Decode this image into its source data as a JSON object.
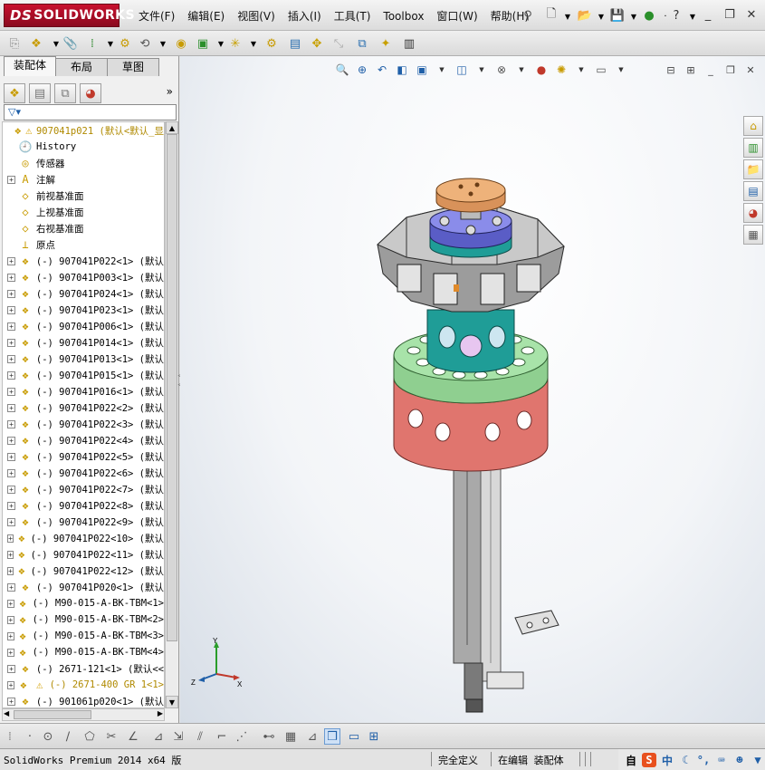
{
  "app": {
    "logo_text": "SOLIDWORKS",
    "logo_prefix": "DS"
  },
  "menu": [
    "文件(F)",
    "编辑(E)",
    "视图(V)",
    "插入(I)",
    "工具(T)",
    "Toolbox",
    "窗口(W)",
    "帮助(H)"
  ],
  "title_controls": {
    "help": "?"
  },
  "left_tabs": [
    "装配体",
    "布局",
    "草图"
  ],
  "active_tab": "装配体",
  "feature_manager": {
    "more_label": "»",
    "root": {
      "name": "907041p021  (默认<默认_显"
    },
    "items": [
      {
        "label": "History",
        "icon": "history-icon",
        "expand": false
      },
      {
        "label": "传感器",
        "icon": "sensor-icon",
        "expand": false
      },
      {
        "label": "注解",
        "icon": "annotation-icon",
        "expand": true
      },
      {
        "label": "前视基准面",
        "icon": "plane-icon",
        "expand": false
      },
      {
        "label": "上视基准面",
        "icon": "plane-icon",
        "expand": false
      },
      {
        "label": "右视基准面",
        "icon": "plane-icon",
        "expand": false
      },
      {
        "label": "原点",
        "icon": "origin-icon",
        "expand": false
      },
      {
        "label": "(-) 907041P022<1> (默认",
        "icon": "part-icon",
        "expand": true
      },
      {
        "label": "(-) 907041P003<1> (默认",
        "icon": "part-icon",
        "expand": true
      },
      {
        "label": "(-) 907041P024<1> (默认",
        "icon": "part-icon",
        "expand": true
      },
      {
        "label": "(-) 907041P023<1> (默认",
        "icon": "part-icon",
        "expand": true
      },
      {
        "label": "(-) 907041P006<1> (默认",
        "icon": "part-icon",
        "expand": true
      },
      {
        "label": "(-) 907041P014<1> (默认",
        "icon": "part-icon",
        "expand": true
      },
      {
        "label": "(-) 907041P013<1> (默认",
        "icon": "part-icon",
        "expand": true
      },
      {
        "label": "(-) 907041P015<1> (默认",
        "icon": "part-icon",
        "expand": true
      },
      {
        "label": "(-) 907041P016<1> (默认",
        "icon": "part-icon",
        "expand": true
      },
      {
        "label": "(-) 907041P022<2> (默认",
        "icon": "part-icon",
        "expand": true
      },
      {
        "label": "(-) 907041P022<3> (默认",
        "icon": "part-icon",
        "expand": true
      },
      {
        "label": "(-) 907041P022<4> (默认",
        "icon": "part-icon",
        "expand": true
      },
      {
        "label": "(-) 907041P022<5> (默认",
        "icon": "part-icon",
        "expand": true
      },
      {
        "label": "(-) 907041P022<6> (默认",
        "icon": "part-icon",
        "expand": true
      },
      {
        "label": "(-) 907041P022<7> (默认",
        "icon": "part-icon",
        "expand": true
      },
      {
        "label": "(-) 907041P022<8> (默认",
        "icon": "part-icon",
        "expand": true
      },
      {
        "label": "(-) 907041P022<9> (默认",
        "icon": "part-icon",
        "expand": true
      },
      {
        "label": "(-) 907041P022<10> (默认",
        "icon": "part-icon",
        "expand": true
      },
      {
        "label": "(-) 907041P022<11> (默认",
        "icon": "part-icon",
        "expand": true
      },
      {
        "label": "(-) 907041P022<12> (默认",
        "icon": "part-icon",
        "expand": true
      },
      {
        "label": "(-) 907041P020<1> (默认",
        "icon": "part-icon",
        "expand": true
      },
      {
        "label": "(-) M90-015-A-BK-TBM<1>",
        "icon": "part-icon",
        "expand": true
      },
      {
        "label": "(-) M90-015-A-BK-TBM<2>",
        "icon": "part-icon",
        "expand": true
      },
      {
        "label": "(-) M90-015-A-BK-TBM<3>",
        "icon": "part-icon",
        "expand": true
      },
      {
        "label": "(-) M90-015-A-BK-TBM<4>",
        "icon": "part-icon",
        "expand": true
      },
      {
        "label": "(-) 2671-121<1> (默认<<",
        "icon": "part-icon",
        "expand": true
      },
      {
        "label": "(-) 2671-400 GR 1<1>",
        "icon": "assembly-warning-icon",
        "expand": true
      },
      {
        "label": "(-) 901061p020<1> (默认",
        "icon": "part-icon",
        "expand": true
      }
    ]
  },
  "triad": {
    "x": "X",
    "y": "Y",
    "z": "Z"
  },
  "status": {
    "product": "SolidWorks Premium 2014 x64 版",
    "definition": "完全定义",
    "editing": "在编辑 装配体",
    "ime_mode": "自",
    "ime_lang": "中"
  },
  "colors": {
    "brand": "#c8102e",
    "top_plate": "#e8a86a",
    "blue_ring": "#6c6fd6",
    "teal_ring": "#1f9d97",
    "green_disk": "#9fdba0",
    "red_drum": "#e0756e",
    "gray_body": "#9a9a9a"
  }
}
